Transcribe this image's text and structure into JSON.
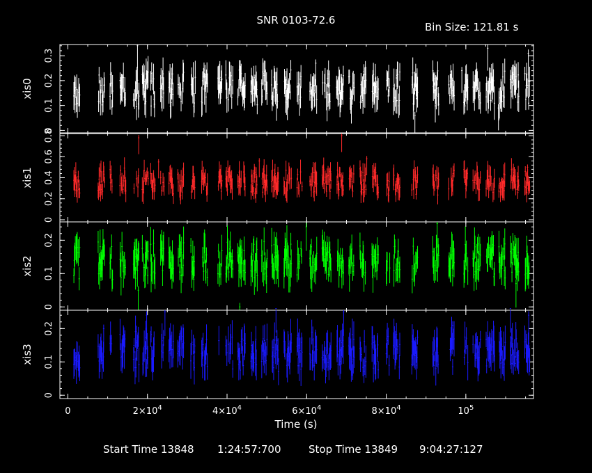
{
  "title": "SNR 0103-72.6",
  "bin_size_label": "Bin Size: 121.81 s",
  "xlabel": "Time (s)",
  "footer": {
    "start_label": "Start Time 13848",
    "start_time": "1:24:57:700",
    "stop_label": "Stop Time 13849",
    "stop_time": "9:04:27:127"
  },
  "colors": {
    "background": "#000000",
    "axes": "#ffffff",
    "xis0": "#ffffff",
    "xis1": "#ff2a2a",
    "xis2": "#00ff00",
    "xis3": "#1a1aff"
  },
  "chart_data": {
    "type": "scatter",
    "subtype": "light-curve-with-error-bars",
    "xlim": [
      -2000,
      117000
    ],
    "x_ticks": [
      {
        "value": 0,
        "label": "0"
      },
      {
        "value": 20000,
        "label": "2×10^4"
      },
      {
        "value": 40000,
        "label": "4×10^4"
      },
      {
        "value": 60000,
        "label": "6×10^4"
      },
      {
        "value": 80000,
        "label": "8×10^4"
      },
      {
        "value": 100000,
        "label": "10^5"
      }
    ],
    "segments_s": [
      [
        1500,
        3200
      ],
      [
        7600,
        9400
      ],
      [
        10600,
        11400
      ],
      [
        13100,
        14700
      ],
      [
        16500,
        18000
      ],
      [
        18700,
        20300
      ],
      [
        20800,
        22100
      ],
      [
        23300,
        24300
      ],
      [
        25400,
        26700
      ],
      [
        27600,
        29200
      ],
      [
        30900,
        32200
      ],
      [
        33600,
        35300
      ],
      [
        37700,
        38900
      ],
      [
        39700,
        41600
      ],
      [
        42700,
        44700
      ],
      [
        46000,
        47800
      ],
      [
        48700,
        50200
      ],
      [
        51200,
        53100
      ],
      [
        54300,
        56300
      ],
      [
        57600,
        59000
      ],
      [
        60800,
        62700
      ],
      [
        63900,
        66300
      ],
      [
        67500,
        69400
      ],
      [
        70600,
        72100
      ],
      [
        73400,
        75000
      ],
      [
        76400,
        78200
      ],
      [
        80000,
        81000
      ],
      [
        81800,
        83600
      ],
      [
        86400,
        88100
      ],
      [
        91700,
        93400
      ],
      [
        95700,
        97200
      ],
      [
        99500,
        100600
      ],
      [
        101800,
        103800
      ],
      [
        105100,
        107300
      ],
      [
        108300,
        110100
      ],
      [
        111200,
        113400
      ],
      [
        114800,
        116200
      ]
    ],
    "panels": [
      {
        "name": "xis0",
        "ylabel": "xis0",
        "color": "#ffffff",
        "ylim": [
          -0.01,
          0.345
        ],
        "y_ticks": [
          0,
          0.1,
          0.2,
          0.3
        ],
        "mean_rate": 0.17,
        "typical_range": [
          0.1,
          0.25
        ],
        "seed": 11,
        "points": [
          [
            1800,
            0.16
          ],
          [
            8200,
            0.15
          ],
          [
            17500,
            0.34
          ],
          [
            48700,
            0.19
          ],
          [
            62300,
            0.27
          ],
          [
            87200,
            0.06
          ],
          [
            99000,
            0.24
          ],
          [
            105500,
            0.33
          ],
          [
            108200,
            0.09
          ],
          [
            115700,
            0.31
          ]
        ]
      },
      {
        "name": "xis1",
        "ylabel": "xis1",
        "color": "#ff2a2a",
        "ylim": [
          -0.02,
          0.82
        ],
        "y_ticks": [
          0,
          0.2,
          0.4,
          0.6,
          0.8
        ],
        "mean_rate": 0.36,
        "typical_range": [
          0.24,
          0.5
        ],
        "seed": 23,
        "points": [
          [
            1800,
            0.4
          ],
          [
            17800,
            0.78
          ],
          [
            22800,
            0.55
          ],
          [
            48100,
            0.56
          ],
          [
            64200,
            0.5
          ],
          [
            68800,
            0.8
          ],
          [
            75100,
            0.58
          ],
          [
            115500,
            0.5
          ]
        ]
      },
      {
        "name": "xis2",
        "ylabel": "xis2",
        "color": "#00ff00",
        "ylim": [
          -0.01,
          0.255
        ],
        "y_ticks": [
          0,
          0.1,
          0.2
        ],
        "mean_rate": 0.14,
        "typical_range": [
          0.09,
          0.21
        ],
        "seed": 37,
        "points": [
          [
            2200,
            0.2
          ],
          [
            17700,
            0.05
          ],
          [
            43200,
            0.0
          ],
          [
            59900,
            0.24
          ],
          [
            92800,
            0.25
          ],
          [
            112600,
            0.07
          ]
        ]
      },
      {
        "name": "xis3",
        "ylabel": "xis3",
        "color": "#1a1aff",
        "ylim": [
          -0.01,
          0.255
        ],
        "y_ticks": [
          0,
          0.1,
          0.2
        ],
        "mean_rate": 0.13,
        "typical_range": [
          0.08,
          0.2
        ],
        "seed": 53,
        "points": [
          [
            9000,
            0.2
          ],
          [
            19800,
            0.24
          ],
          [
            24400,
            0.25
          ],
          [
            52300,
            0.26
          ],
          [
            69300,
            0.25
          ],
          [
            96700,
            0.21
          ],
          [
            111200,
            0.26
          ],
          [
            115800,
            0.24
          ]
        ]
      }
    ]
  }
}
